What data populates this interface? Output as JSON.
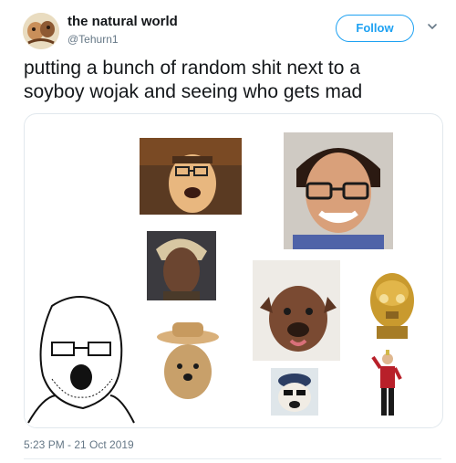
{
  "user": {
    "display_name": "the natural world",
    "handle": "@Tehurn1",
    "avatar_icon": "profile-avatar"
  },
  "actions": {
    "follow_label": "Follow",
    "more_icon": "chevron-down-icon"
  },
  "tweet": {
    "text_line1": "putting a bunch of random shit next to a",
    "text_line2": "soyboy wojak and seeing who gets mad",
    "timestamp": "5:23 PM - 21 Oct 2019"
  },
  "colors": {
    "accent": "#1da1f2",
    "secondary_text": "#657786",
    "primary_text": "#14171a",
    "border": "#e1e8ed"
  }
}
